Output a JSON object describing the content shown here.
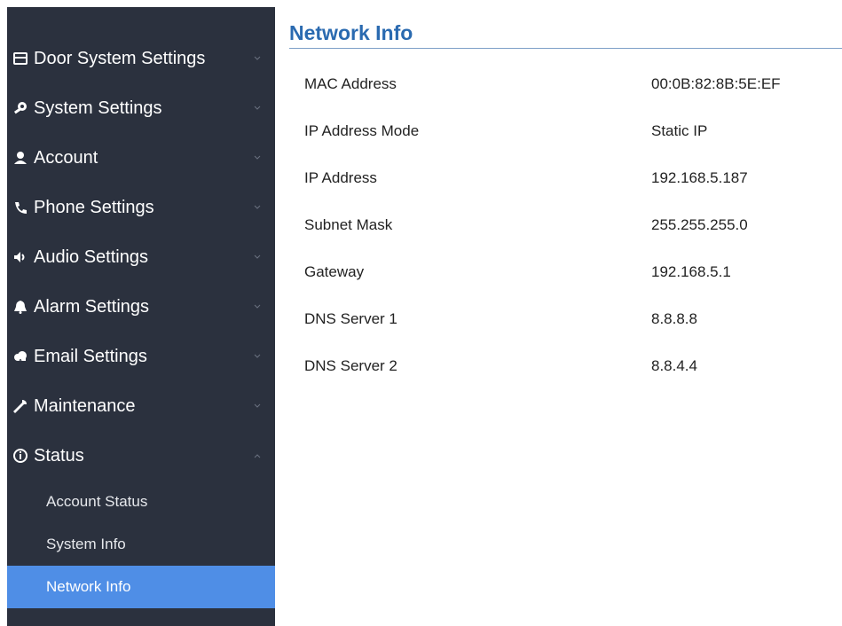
{
  "sidebar": {
    "items": [
      {
        "label": "Door System Settings",
        "icon": "door-panel-icon",
        "expanded": false
      },
      {
        "label": "System Settings",
        "icon": "wrench-key-icon",
        "expanded": false
      },
      {
        "label": "Account",
        "icon": "user-icon",
        "expanded": false
      },
      {
        "label": "Phone Settings",
        "icon": "phone-icon",
        "expanded": false
      },
      {
        "label": "Audio Settings",
        "icon": "speaker-icon",
        "expanded": false
      },
      {
        "label": "Alarm Settings",
        "icon": "bell-icon",
        "expanded": false
      },
      {
        "label": "Email Settings",
        "icon": "cloud-icon",
        "expanded": false
      },
      {
        "label": "Maintenance",
        "icon": "wrench-icon",
        "expanded": false
      },
      {
        "label": "Status",
        "icon": "info-circle-icon",
        "expanded": true
      }
    ],
    "status_submenu": [
      {
        "label": "Account Status",
        "active": false
      },
      {
        "label": "System Info",
        "active": false
      },
      {
        "label": "Network Info",
        "active": true
      }
    ]
  },
  "main": {
    "title": "Network Info",
    "rows": [
      {
        "key": "MAC Address",
        "value": "00:0B:82:8B:5E:EF"
      },
      {
        "key": "IP Address Mode",
        "value": "Static IP"
      },
      {
        "key": "IP Address",
        "value": "192.168.5.187"
      },
      {
        "key": "Subnet Mask",
        "value": "255.255.255.0"
      },
      {
        "key": "Gateway",
        "value": "192.168.5.1"
      },
      {
        "key": "DNS Server 1",
        "value": "8.8.8.8"
      },
      {
        "key": "DNS Server 2",
        "value": "8.8.4.4"
      }
    ]
  },
  "colors": {
    "sidebar_bg": "#2b313e",
    "active_item_bg": "#4f8ee6",
    "title_color": "#2a6ab0"
  }
}
